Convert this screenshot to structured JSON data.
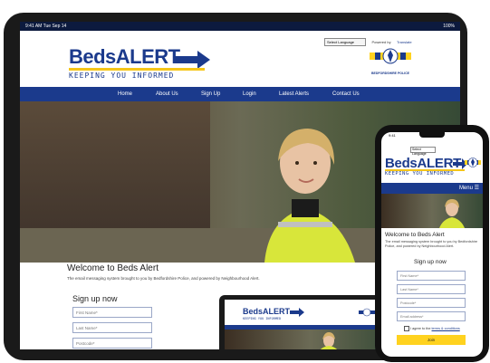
{
  "tablet": {
    "status_time": "9:41 AM   Tue Sep 14",
    "status_right": "100%",
    "language_select": "Select Language",
    "powered_by": "Powered by",
    "translate": "Translate",
    "logo_beds": "Beds",
    "logo_alert": "ALERT",
    "logo_tagline": "KEEPING YOU INFORMED",
    "police_name": "BEDFORDSHIRE POLICE",
    "nav": [
      "Home",
      "About Us",
      "Sign Up",
      "Login",
      "Latest Alerts",
      "Contact Us"
    ],
    "welcome_title": "Welcome to Beds Alert",
    "welcome_sub": "The email messaging system brought to you by Bedfordshire Police, and powered by Neighbourhood Alert.",
    "signup_title": "Sign up now",
    "fields": [
      "First Name*",
      "Last Name*",
      "Postcode*"
    ]
  },
  "laptop": {
    "logo_beds": "Beds",
    "logo_alert": "ALERT",
    "logo_tagline": "KEEPING YOU INFORMED"
  },
  "phone": {
    "status_time": "9:41",
    "language_select": "Select Language",
    "logo_beds": "Beds",
    "logo_alert": "ALERT",
    "logo_tagline": "KEEPING YOU INFORMED",
    "menu_label": "Menu ☰",
    "welcome_title": "Welcome to Beds Alert",
    "welcome_sub": "The email messaging system brought to you by Bedfordshire Police, and powered by Neighbourhood Alert.",
    "signup_title": "Sign up now",
    "fields": [
      "First Name*",
      "Last Name*",
      "Postcode*",
      "Email address*"
    ],
    "terms_prefix": "I agree to the ",
    "terms_link": "terms & conditions",
    "join_label": "Join"
  },
  "colors": {
    "brand_blue": "#1b3a8c",
    "join_yellow": "#ffd21f"
  }
}
